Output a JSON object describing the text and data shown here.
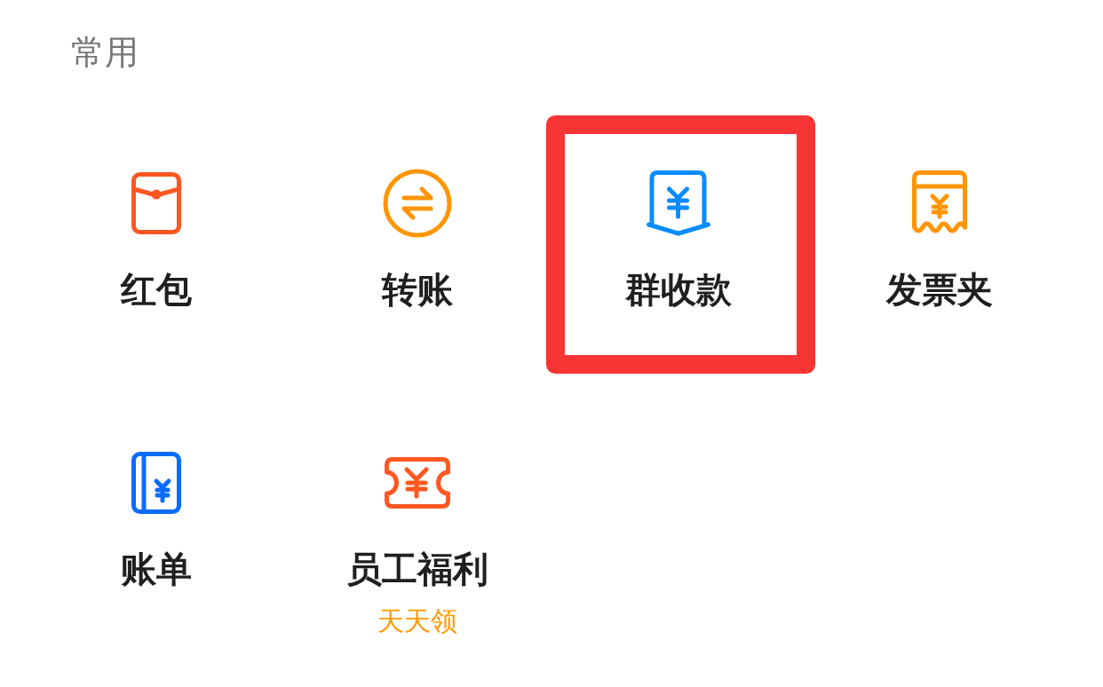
{
  "section": {
    "title": "常用"
  },
  "items": [
    {
      "label": "红包",
      "color": "#ff5722",
      "highlighted": false
    },
    {
      "label": "转账",
      "color": "#ff9500",
      "highlighted": false
    },
    {
      "label": "群收款",
      "color": "#0a8cff",
      "highlighted": true
    },
    {
      "label": "发票夹",
      "color": "#ff9500",
      "highlighted": false
    },
    {
      "label": "账单",
      "color": "#0a6cff",
      "highlighted": false
    },
    {
      "label": "员工福利",
      "subtitle": "天天领",
      "color": "#ff5722",
      "highlighted": false
    }
  ]
}
